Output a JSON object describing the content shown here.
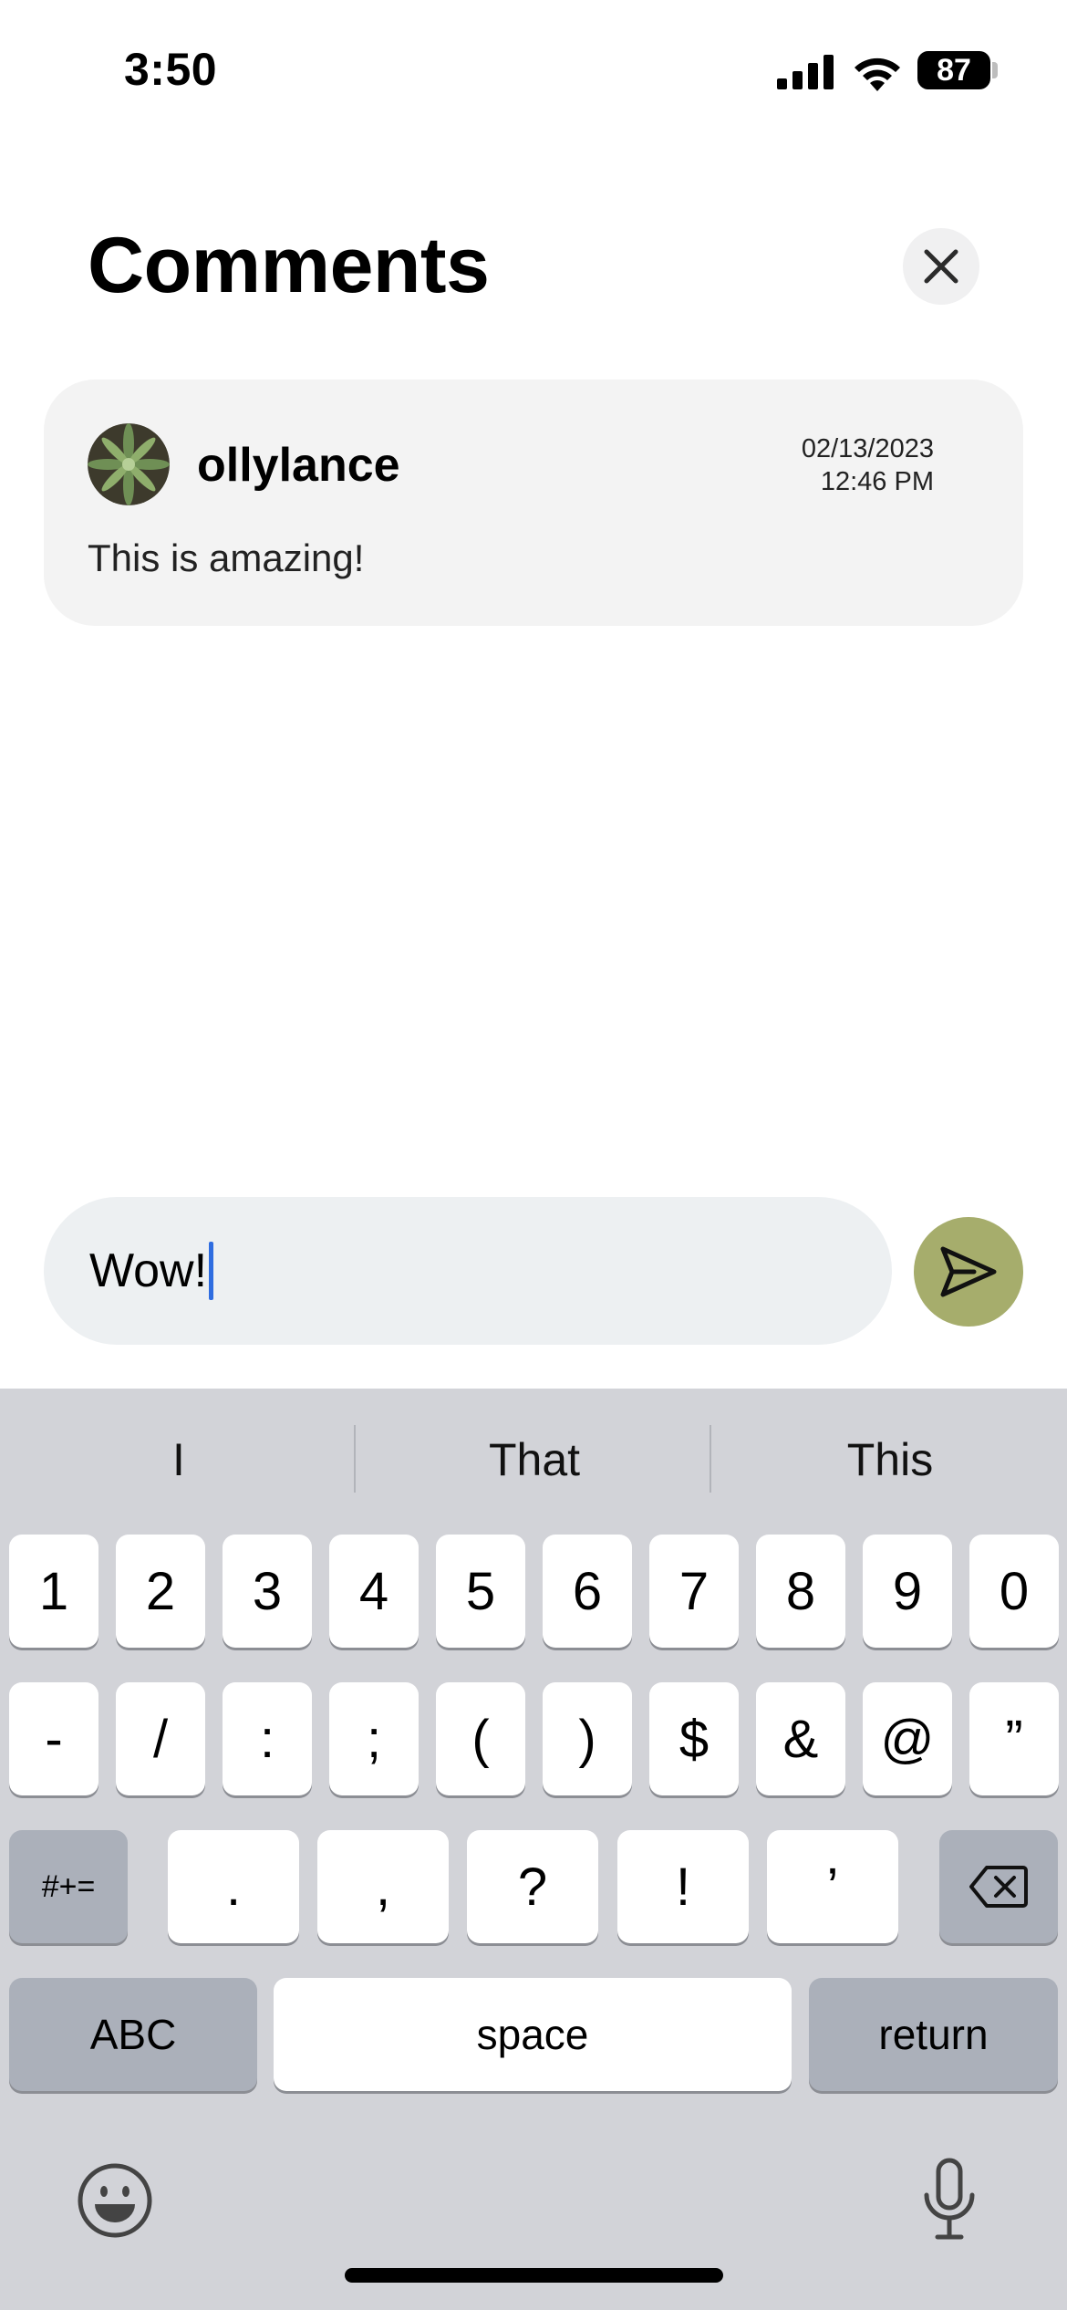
{
  "status_bar": {
    "time": "3:50",
    "battery": "87",
    "icons": [
      "cellular-signal-icon",
      "wifi-icon",
      "battery-icon"
    ]
  },
  "header": {
    "title": "Comments",
    "close_icon": "close-icon"
  },
  "comments": [
    {
      "username": "ollylance",
      "date": "02/13/2023",
      "time": "12:46 PM",
      "text": "This is amazing!"
    }
  ],
  "composer": {
    "value": "Wow!",
    "send_icon": "send-icon",
    "send_color": "#a6ad6c"
  },
  "keyboard": {
    "suggestions": [
      "I",
      "That",
      "This"
    ],
    "row1": [
      "1",
      "2",
      "3",
      "4",
      "5",
      "6",
      "7",
      "8",
      "9",
      "0"
    ],
    "row2": [
      "-",
      "/",
      ":",
      ";",
      "(",
      ")",
      "$",
      "&",
      "@",
      "”"
    ],
    "row3_left": "#+=",
    "row3": [
      ".",
      ",",
      "?",
      "!",
      "’"
    ],
    "row3_right_icon": "delete-icon",
    "abc": "ABC",
    "space": "space",
    "return": "return",
    "emoji_icon": "emoji-icon",
    "mic_icon": "microphone-icon"
  }
}
